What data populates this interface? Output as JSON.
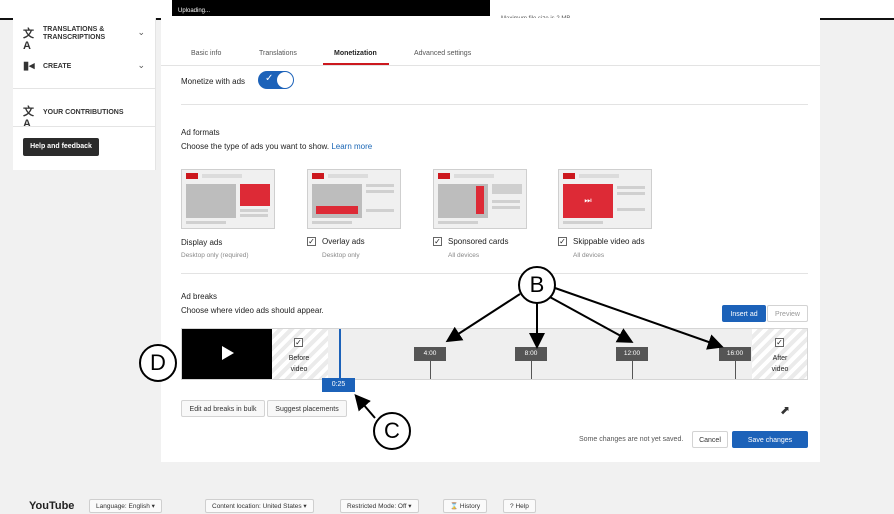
{
  "upload": {
    "status": "Uploading...",
    "max_size": "Maximum file size is 2 MB."
  },
  "sidebar": {
    "items": [
      {
        "label": "TRANSLATIONS & TRANSCRIPTIONS",
        "icon": "translate-icon"
      },
      {
        "label": "CREATE",
        "icon": "video-camera-icon"
      },
      {
        "label": "YOUR CONTRIBUTIONS",
        "icon": "translate-icon"
      }
    ],
    "help_label": "Help and feedback"
  },
  "tabs": [
    "Basic info",
    "Translations",
    "Monetization",
    "Advanced settings"
  ],
  "active_tab": "Monetization",
  "monetize": {
    "label": "Monetize with ads",
    "enabled": true
  },
  "ad_formats": {
    "heading": "Ad formats",
    "description": "Choose the type of ads you want to show.",
    "learn_more": "Learn more",
    "items": [
      {
        "label": "Display ads",
        "sub": "Desktop only (required)",
        "checkbox": false
      },
      {
        "label": "Overlay ads",
        "sub": "Desktop only",
        "checkbox": true
      },
      {
        "label": "Sponsored cards",
        "sub": "All devices",
        "checkbox": true
      },
      {
        "label": "Skippable video ads",
        "sub": "All devices",
        "checkbox": true
      }
    ]
  },
  "ad_breaks": {
    "heading": "Ad breaks",
    "description": "Choose where video ads should appear.",
    "insert_ad": "Insert ad",
    "preview": "Preview",
    "before_video": "Before video",
    "after_video": "After video",
    "markers": [
      "4:00",
      "8:00",
      "12:00",
      "16:00"
    ],
    "current_time": "0:25",
    "edit_bulk": "Edit ad breaks in bulk",
    "suggest": "Suggest placements"
  },
  "footer_actions": {
    "unsaved": "Some changes are not yet saved.",
    "cancel": "Cancel",
    "save": "Save changes"
  },
  "callouts": {
    "b": "B",
    "c": "C",
    "d": "D"
  },
  "footer": {
    "logo": "YouTube",
    "language": "Language: English",
    "location": "Content location: United States",
    "restricted": "Restricted Mode: Off",
    "history": "History",
    "help": "Help"
  },
  "colors": {
    "accent_blue": "#1c62b9",
    "brand_red": "#cc181e"
  }
}
